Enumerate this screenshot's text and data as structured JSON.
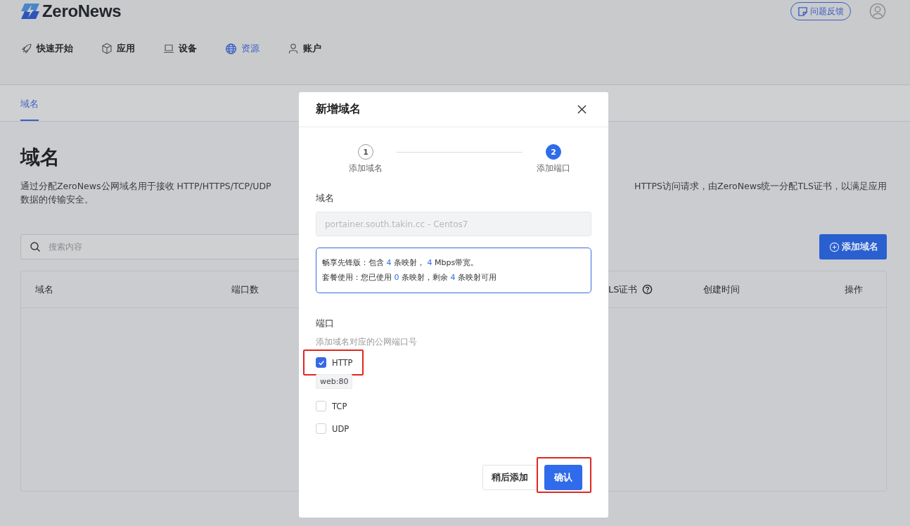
{
  "brand": {
    "name": "ZeroNews"
  },
  "feedback_button": {
    "label": "问题反馈"
  },
  "nav": [
    {
      "label": "快速开始",
      "selected": false
    },
    {
      "label": "应用",
      "selected": false
    },
    {
      "label": "设备",
      "selected": false
    },
    {
      "label": "资源",
      "selected": true
    },
    {
      "label": "账户",
      "selected": false
    }
  ],
  "subtabs": [
    {
      "label": "域名",
      "selected": true
    }
  ],
  "page_title": "域名",
  "description": {
    "line_1_left": "通过分配ZeroNews公网域名用于接收 HTTP/HTTPS/TCP/UDP",
    "line_1_right": "HTTPS访问请求，由ZeroNews统一分配TLS证书，以满足应用",
    "line_2": "数据的传输安全。"
  },
  "search": {
    "placeholder": "搜索内容"
  },
  "add_button": {
    "label": "添加域名"
  },
  "table": {
    "columns": [
      {
        "label": "域名",
        "help": false
      },
      {
        "label": "端口数",
        "help": false
      },
      {
        "label": "LS证书",
        "help": true
      },
      {
        "label": "创建时间",
        "help": false
      },
      {
        "label": "操作",
        "help": false
      }
    ]
  },
  "dialog": {
    "title": "新增域名",
    "steps": [
      {
        "number": "1",
        "label": "添加域名",
        "selected": false
      },
      {
        "number": "2",
        "label": "添加端口",
        "selected": true
      }
    ],
    "domain_field": {
      "label": "域名",
      "value": "portainer.south.takin.cc - Centos7",
      "disabled": true
    },
    "plan_info": [
      [
        {
          "kind": "text",
          "text": "畅享先锋版：包含 "
        },
        {
          "kind": "number",
          "text": "4"
        },
        {
          "kind": "text",
          "text": " 条映射， "
        },
        {
          "kind": "number",
          "text": "4"
        },
        {
          "kind": "text",
          "text": " Mbps带宽。"
        }
      ],
      [
        {
          "kind": "text",
          "text": "套餐使用：您已使用 "
        },
        {
          "kind": "number",
          "text": "0"
        },
        {
          "kind": "text",
          "text": " 条映射，剩余 "
        },
        {
          "kind": "number",
          "text": "4"
        },
        {
          "kind": "text",
          "text": " 条映射可用"
        }
      ]
    ],
    "ports": {
      "label": "端口",
      "hint": "添加域名对应的公网端口号",
      "options": [
        {
          "label": "HTTP",
          "checked": true,
          "highlighted": true,
          "tag": "web:80"
        },
        {
          "label": "TCP",
          "checked": false,
          "highlighted": false
        },
        {
          "label": "UDP",
          "checked": false,
          "highlighted": false
        }
      ]
    },
    "buttons": [
      {
        "label": "稍后添加",
        "kind": "secondary",
        "highlighted": false
      },
      {
        "label": "确认",
        "kind": "primary",
        "highlighted": true
      }
    ]
  }
}
